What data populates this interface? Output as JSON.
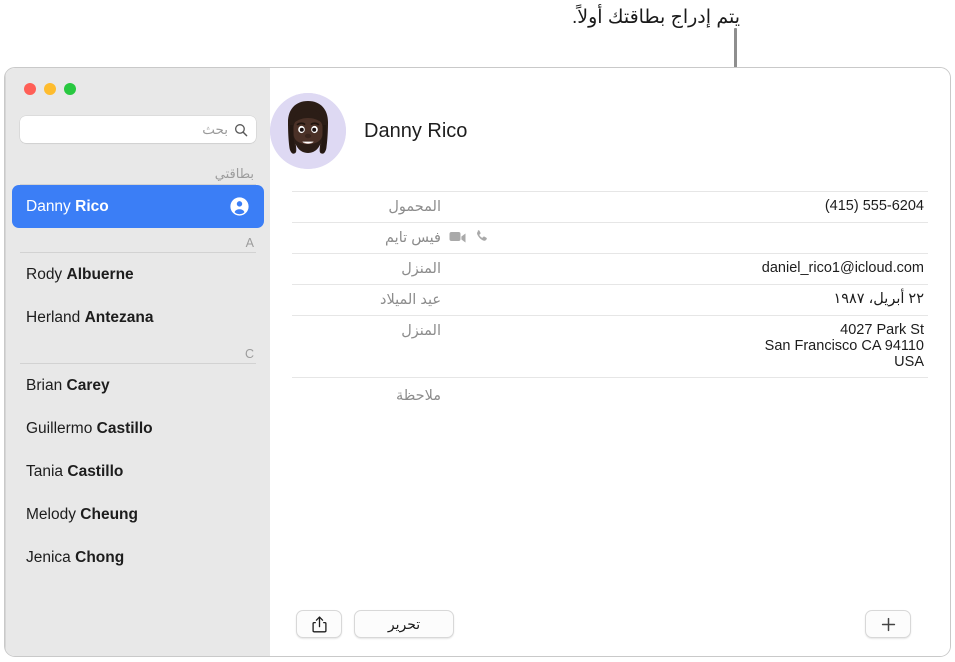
{
  "callout": {
    "text": "يتم إدراج بطاقتك أولاً."
  },
  "sidebar": {
    "traffic_lights": [
      "green",
      "yellow",
      "red"
    ],
    "search": {
      "placeholder": "بحث",
      "value": "",
      "icon": "search-icon"
    },
    "groups": [
      {
        "header": "بطاقتي",
        "header_is_latin": false,
        "contacts": [
          {
            "first": "Danny",
            "last": "Rico",
            "selected": true,
            "icon": "person-circle-icon"
          }
        ]
      },
      {
        "header": "A",
        "header_is_latin": true,
        "contacts": [
          {
            "first": "Rody",
            "last": "Albuerne",
            "selected": false
          },
          {
            "first": "Herland",
            "last": "Antezana",
            "selected": false
          }
        ]
      },
      {
        "header": "C",
        "header_is_latin": true,
        "contacts": [
          {
            "first": "Brian",
            "last": "Carey",
            "selected": false
          },
          {
            "first": "Guillermo",
            "last": "Castillo",
            "selected": false
          },
          {
            "first": "Tania",
            "last": "Castillo",
            "selected": false
          },
          {
            "first": "Melody",
            "last": "Cheung",
            "selected": false
          },
          {
            "first": "Jenica",
            "last": "Chong",
            "selected": false
          }
        ]
      }
    ]
  },
  "detail": {
    "name": "Danny Rico",
    "avatar": {
      "type": "memoji",
      "background_color": "#ded9f3",
      "skin_color": "#4a3128",
      "hair_color": "#2e1f18"
    },
    "fields": [
      {
        "label": "المحمول",
        "value": "(415) 555-6204",
        "rtl": false,
        "kind": "text"
      },
      {
        "label": "فيس تايم",
        "value": "",
        "rtl": false,
        "kind": "facetime",
        "icons": [
          "video-camera-icon",
          "phone-handset-icon"
        ]
      },
      {
        "label": "المنزل",
        "value": "daniel_rico1@icloud.com",
        "rtl": false,
        "kind": "text"
      },
      {
        "label": "عيد الميلاد",
        "value": "٢٢ أبريل، ١٩٨٧",
        "rtl": true,
        "kind": "text"
      },
      {
        "label": "المنزل",
        "value": "",
        "rtl": false,
        "kind": "address",
        "lines": [
          "4027 Park St",
          "San Francisco CA 94110",
          "USA"
        ]
      },
      {
        "label": "ملاحظة",
        "value": "",
        "rtl": true,
        "kind": "note"
      }
    ],
    "buttons": {
      "share": {
        "label": "",
        "icon": "share-icon"
      },
      "edit": {
        "label": "تحرير",
        "icon": ""
      },
      "add": {
        "label": "",
        "icon": "plus-icon"
      }
    }
  },
  "colors": {
    "selection_blue": "#3b7ef6",
    "sidebar_bg": "#e8e8e8",
    "detail_bg": "#ffffff",
    "label_gray": "#8c8c8c",
    "separator": "#e6e6e6"
  }
}
